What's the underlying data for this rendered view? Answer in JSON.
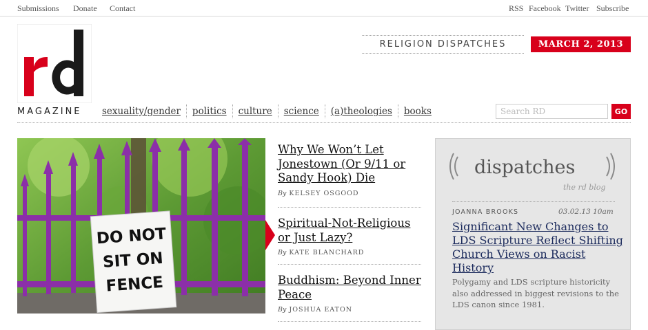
{
  "top_nav": {
    "left": [
      "Submissions",
      "Donate",
      "Contact"
    ],
    "right": [
      "RSS",
      "Facebook",
      "Twitter",
      "Subscribe"
    ]
  },
  "logo": {
    "letters": "rd",
    "magazine_label": "MAGAZINE"
  },
  "header": {
    "section_label": "RELIGION DISPATCHES",
    "date": "MARCH 2, 2013"
  },
  "nav": {
    "items": [
      "sexuality/gender",
      "politics",
      "culture",
      "science",
      "(a)theologies",
      "books"
    ]
  },
  "search": {
    "placeholder": "Search RD",
    "button_label": "GO"
  },
  "hero_image": {
    "sign_text": [
      "DO NOT",
      "SIT ON",
      "FENCE"
    ]
  },
  "stories": [
    {
      "title": "Why We Won’t Let Jonestown (Or 9/11 or Sandy Hook) Die",
      "by": "By",
      "author": "KELSEY OSGOOD"
    },
    {
      "title": "Spiritual-Not-Religious or Just Lazy?",
      "by": "By",
      "author": "KATE BLANCHARD"
    },
    {
      "title": "Buddhism: Beyond Inner Peace",
      "by": "By",
      "author": "JOSHUA EATON"
    }
  ],
  "sidebar": {
    "logo_word": "dispatches",
    "logo_sub": "the rd blog",
    "post": {
      "author": "JOANNA BROOKS",
      "timestamp": "03.02.13 10am",
      "title": "Significant New Changes to LDS Scripture Reflect Shifting Church Views on Racist History",
      "summary": "Polygamy and LDS scripture historicity also addressed in biggest revisions to the LDS canon since 1981."
    }
  },
  "colors": {
    "brand_red": "#d8001b",
    "link_navy": "#1b2a5c",
    "sidebar_bg": "#e6e6e6"
  }
}
